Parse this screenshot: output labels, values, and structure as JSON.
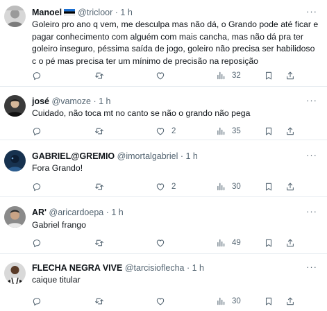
{
  "tweets": [
    {
      "name": "Manoel",
      "flag_icon": "estonia-flag-icon",
      "handle": "@tricloor",
      "time": "1 h",
      "lines": [
        "Goleiro pro ano q vem, me desculpa mas não dá, o Grando pode até ficar e",
        "pagar conhecimento com alguém com mais cancha, mas não dá pra ter",
        "goleiro inseguro, péssima saída de jogo, goleiro não precisa ser habilidoso",
        "c o pé mas precisa ter um mínimo de precisão na reposição"
      ],
      "replies": "",
      "retweets": "",
      "likes": "",
      "views": "32"
    },
    {
      "name": "josé",
      "handle": "@vamoze",
      "time": "1 h",
      "lines": [
        "Cuidado, não toca mt no canto se não o grando não pega"
      ],
      "replies": "",
      "retweets": "",
      "likes": "2",
      "views": "35"
    },
    {
      "name": "GABRIEL@GREMIO",
      "handle": "@imortalgabriel",
      "time": "1 h",
      "lines": [
        "Fora Grando!"
      ],
      "replies": "",
      "retweets": "",
      "likes": "2",
      "views": "30"
    },
    {
      "name": "AR'",
      "handle": "@aricardoepa",
      "time": "1 h",
      "lines": [
        "Gabriel frango"
      ],
      "replies": "",
      "retweets": "",
      "likes": "",
      "views": "49"
    },
    {
      "name": "FLECHA NEGRA VIVE",
      "handle": "@tarcisioflecha",
      "time": "1 h",
      "lines": [
        "caique titular"
      ],
      "replies": "",
      "retweets": "",
      "likes": "",
      "views": "30"
    }
  ],
  "separator": "·",
  "more_icon": "more-horizontal-icon",
  "action_icons": [
    "reply-icon",
    "retweet-icon",
    "like-icon",
    "views-icon",
    "bookmark-icon",
    "share-icon"
  ],
  "colors": {
    "text": "#0f1419",
    "secondary": "#536471",
    "border": "#e6ecf0"
  }
}
